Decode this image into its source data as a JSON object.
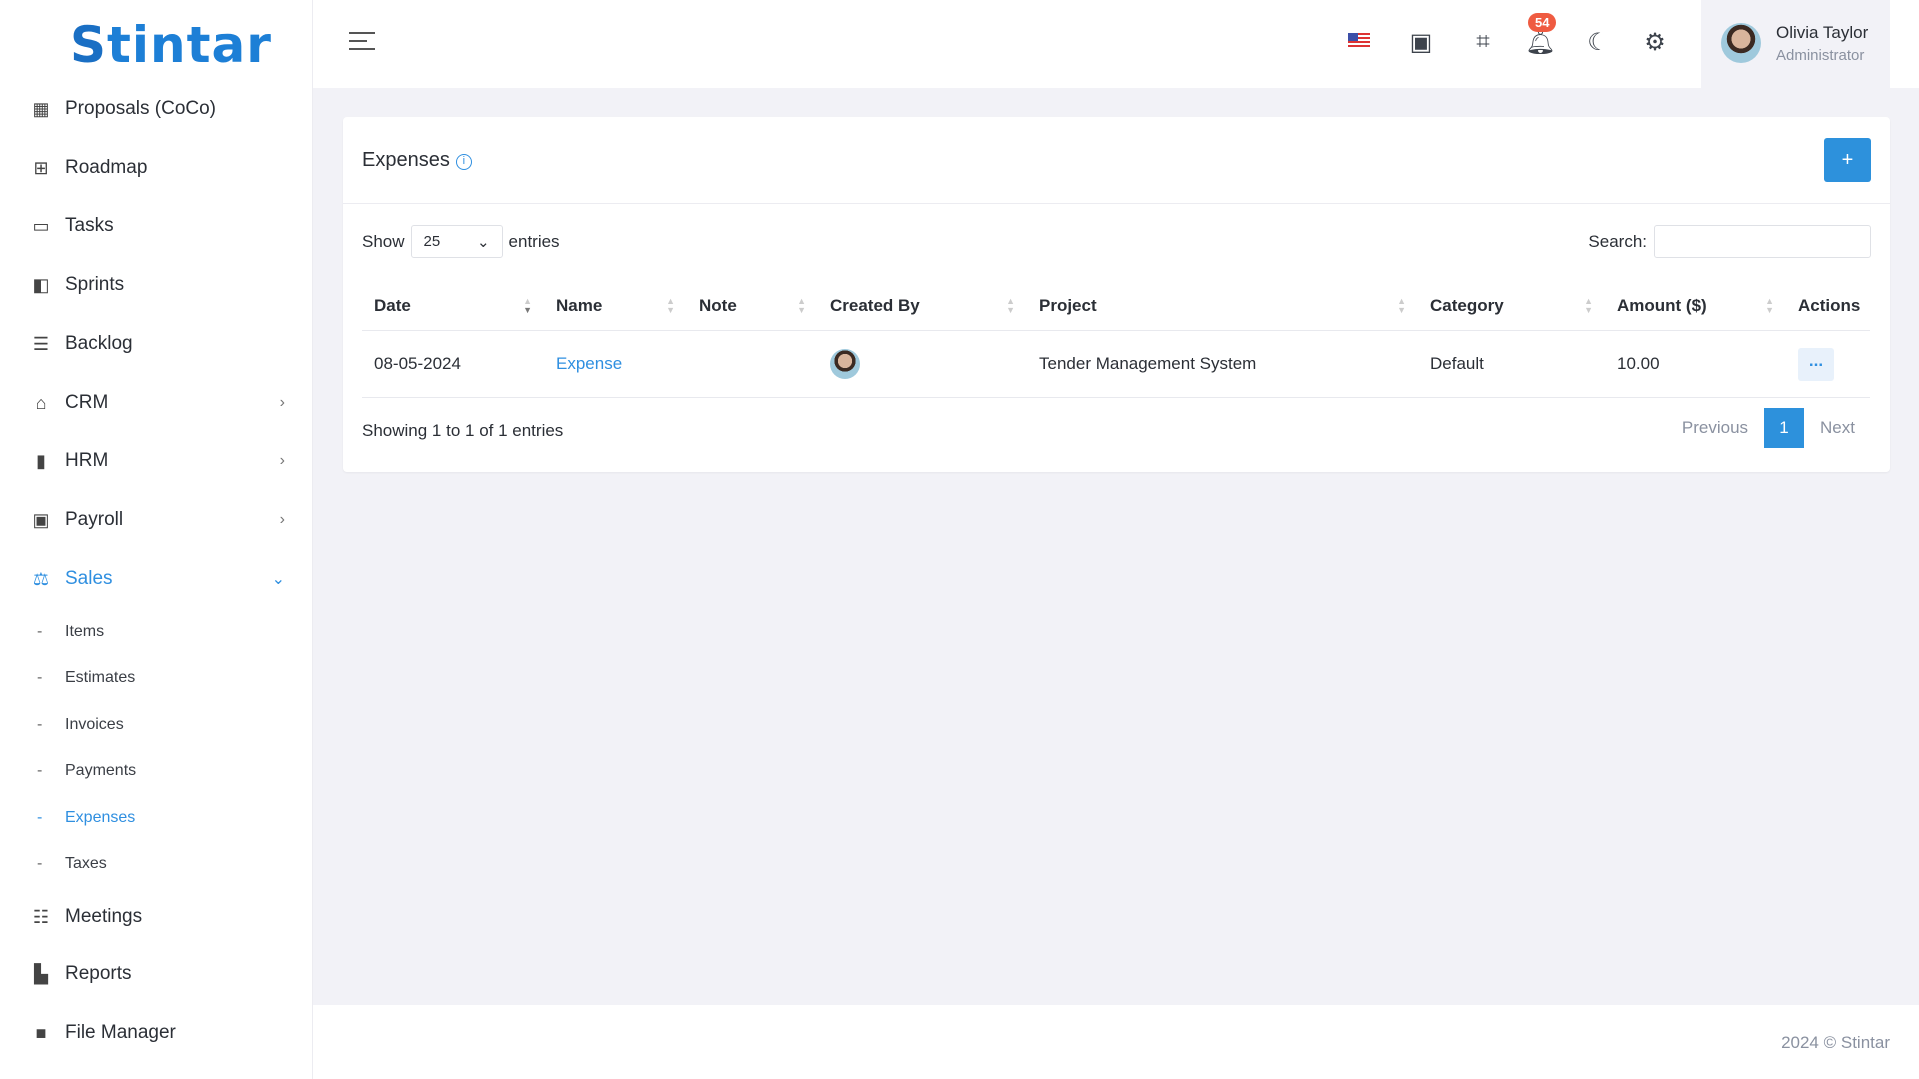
{
  "brand": "Stintar",
  "sidebar": {
    "items": [
      {
        "label": "Proposals (CoCo)",
        "icon": "blueprint-icon"
      },
      {
        "label": "Roadmap",
        "icon": "sitemap-icon"
      },
      {
        "label": "Tasks",
        "icon": "ticket-icon"
      },
      {
        "label": "Sprints",
        "icon": "board-icon"
      },
      {
        "label": "Backlog",
        "icon": "list-icon"
      },
      {
        "label": "CRM",
        "icon": "handshake-icon"
      },
      {
        "label": "HRM",
        "icon": "team-icon"
      },
      {
        "label": "Payroll",
        "icon": "payroll-icon"
      },
      {
        "label": "Sales",
        "icon": "scale-icon"
      },
      {
        "label": "Meetings",
        "icon": "people-icon"
      },
      {
        "label": "Reports",
        "icon": "chart-icon"
      },
      {
        "label": "File Manager",
        "icon": "folder-icon"
      }
    ],
    "sales_sub": [
      "Items",
      "Estimates",
      "Invoices",
      "Payments",
      "Expenses",
      "Taxes"
    ]
  },
  "header": {
    "notifications": "54",
    "user": {
      "name": "Olivia Taylor",
      "role": "Administrator"
    }
  },
  "card": {
    "title": "Expenses",
    "add_label": "+",
    "show": "Show",
    "entries": "entries",
    "page_size": "25",
    "search_label": "Search:",
    "search_value": "",
    "columns": [
      "Date",
      "Name",
      "Note",
      "Created By",
      "Project",
      "Category",
      "Amount ($)",
      "Actions"
    ],
    "rows": [
      {
        "date": "08-05-2024",
        "name": "Expense",
        "note": "",
        "project": "Tender Management System",
        "category": "Default",
        "amount": "10.00",
        "actions": "..."
      }
    ],
    "showing": "Showing 1 to 1 of 1 entries",
    "prev": "Previous",
    "page": "1",
    "next": "Next"
  },
  "footer": "2024 © Stintar",
  "colors": {
    "accent": "#2d91dc",
    "badge": "#ef5b41"
  }
}
